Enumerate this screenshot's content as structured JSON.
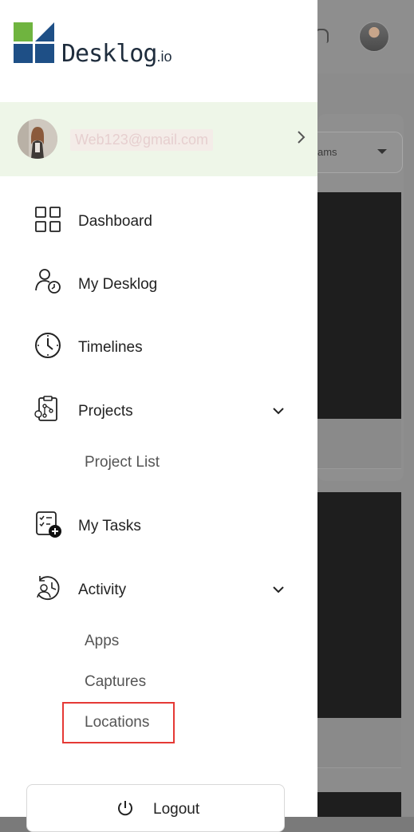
{
  "app": {
    "logo_name": "Desklog",
    "logo_suffix": ".io",
    "brand_colors": {
      "green": "#6fb43f",
      "navy": "#1e4f86"
    }
  },
  "profile": {
    "email": "Web123@gmail.com"
  },
  "nav": {
    "dashboard": "Dashboard",
    "my_desklog": "My Desklog",
    "timelines": "Timelines",
    "projects": "Projects",
    "project_list": "Project List",
    "my_tasks": "My Tasks",
    "activity": "Activity",
    "apps": "Apps",
    "captures": "Captures",
    "locations": "Locations"
  },
  "logout": {
    "label": "Logout"
  },
  "background": {
    "select_partial_text": "ams"
  },
  "highlight_color": "#e53935"
}
